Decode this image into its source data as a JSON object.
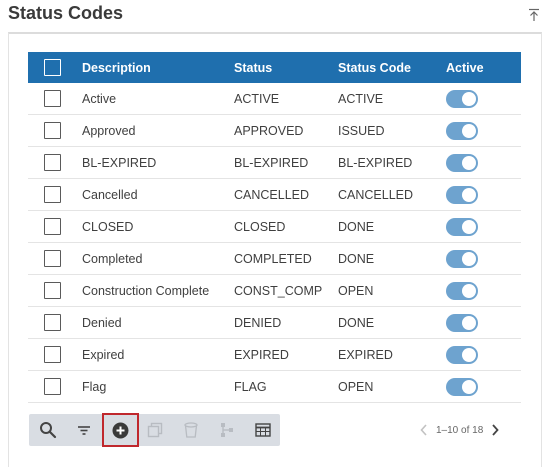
{
  "header": {
    "title": "Status Codes"
  },
  "table": {
    "columns": {
      "description": "Description",
      "status": "Status",
      "status_code": "Status Code",
      "active": "Active"
    },
    "rows": [
      {
        "description": "Active",
        "status": "ACTIVE",
        "code": "ACTIVE",
        "active": true
      },
      {
        "description": "Approved",
        "status": "APPROVED",
        "code": "ISSUED",
        "active": true
      },
      {
        "description": "BL-EXPIRED",
        "status": "BL-EXPIRED",
        "code": "BL-EXPIRED",
        "active": true
      },
      {
        "description": "Cancelled",
        "status": "CANCELLED",
        "code": "CANCELLED",
        "active": true
      },
      {
        "description": "CLOSED",
        "status": "CLOSED",
        "code": "DONE",
        "active": true
      },
      {
        "description": "Completed",
        "status": "COMPLETED",
        "code": "DONE",
        "active": true
      },
      {
        "description": "Construction Complete",
        "status": "CONST_COMP",
        "code": "OPEN",
        "active": true
      },
      {
        "description": "Denied",
        "status": "DENIED",
        "code": "DONE",
        "active": true
      },
      {
        "description": "Expired",
        "status": "EXPIRED",
        "code": "EXPIRED",
        "active": true
      },
      {
        "description": "Flag",
        "status": "FLAG",
        "code": "OPEN",
        "active": true
      }
    ]
  },
  "toolbar": {
    "icons": [
      "search-icon",
      "filter-icon",
      "add-icon",
      "copy-icon",
      "delete-icon",
      "hierarchy-icon",
      "table-icon"
    ]
  },
  "pager": {
    "range_text": "1–10 of 18"
  },
  "colors": {
    "header_bg": "#1f6fae",
    "toggle_on": "#6ea3cf",
    "toolbar_bg": "#d9dde3",
    "highlight_border": "#c0282d"
  }
}
